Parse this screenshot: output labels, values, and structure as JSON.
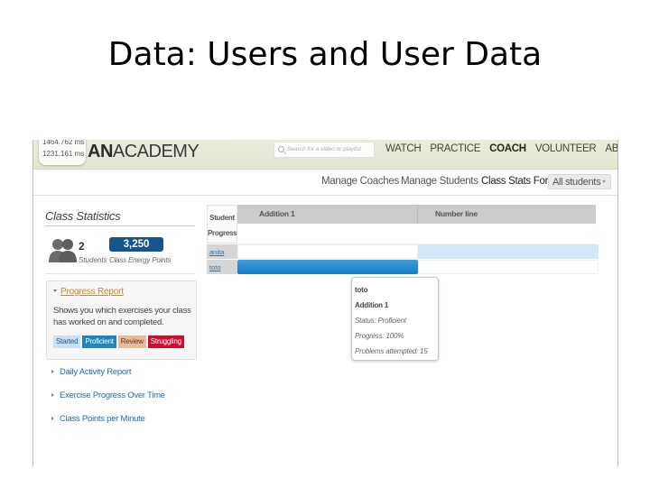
{
  "slide": {
    "title": "Data: Users and User Data"
  },
  "header": {
    "timings": [
      "1464.762 ms",
      "1231.161 ms"
    ],
    "logo_bold": "AN",
    "logo_rest": "ACADEMY",
    "search_placeholder": "Search for a video or playlist",
    "nav": [
      {
        "label": "WATCH",
        "active": false
      },
      {
        "label": "PRACTICE",
        "active": false
      },
      {
        "label": "COACH",
        "active": true
      },
      {
        "label": "VOLUNTEER",
        "active": false
      },
      {
        "label": "ABOUT",
        "active": false
      }
    ]
  },
  "subnav": {
    "manage_coaches": "Manage Coaches",
    "manage_students": "Manage Students",
    "class_stats_for": "Class Stats For",
    "student_filter": "All students"
  },
  "class_stats": {
    "title": "Class Statistics",
    "student_count": "2",
    "students_label": "Students",
    "energy_points": "3,250",
    "energy_points_label": "Class Energy Points"
  },
  "progress_report": {
    "title": "Progress Report",
    "description": "Shows you which exercises your class has worked on and completed.",
    "legend": [
      {
        "label": "Started",
        "color": "#c9e2f3"
      },
      {
        "label": "Proficient",
        "color": "#1e86c3"
      },
      {
        "label": "Review",
        "color": "#e9b99a"
      },
      {
        "label": "Struggling",
        "color": "#c8102e"
      }
    ]
  },
  "reports": [
    "Daily Activity Report",
    "Exercise Progress Over Time",
    "Class Points per Minute"
  ],
  "grid": {
    "student_header_line1": "Student",
    "student_header_line2": "Progress",
    "exercises": [
      "Addition 1",
      "Number line"
    ],
    "students": [
      {
        "name": "anita",
        "status": [
          "none",
          "started"
        ]
      },
      {
        "name": "toto",
        "status": [
          "proficient",
          "none"
        ]
      }
    ]
  },
  "tooltip": {
    "student": "toto",
    "exercise": "Addition 1",
    "status": "Status: Proficient",
    "progress": "Progress: 100%",
    "problems": "Problems attempted: 15"
  }
}
